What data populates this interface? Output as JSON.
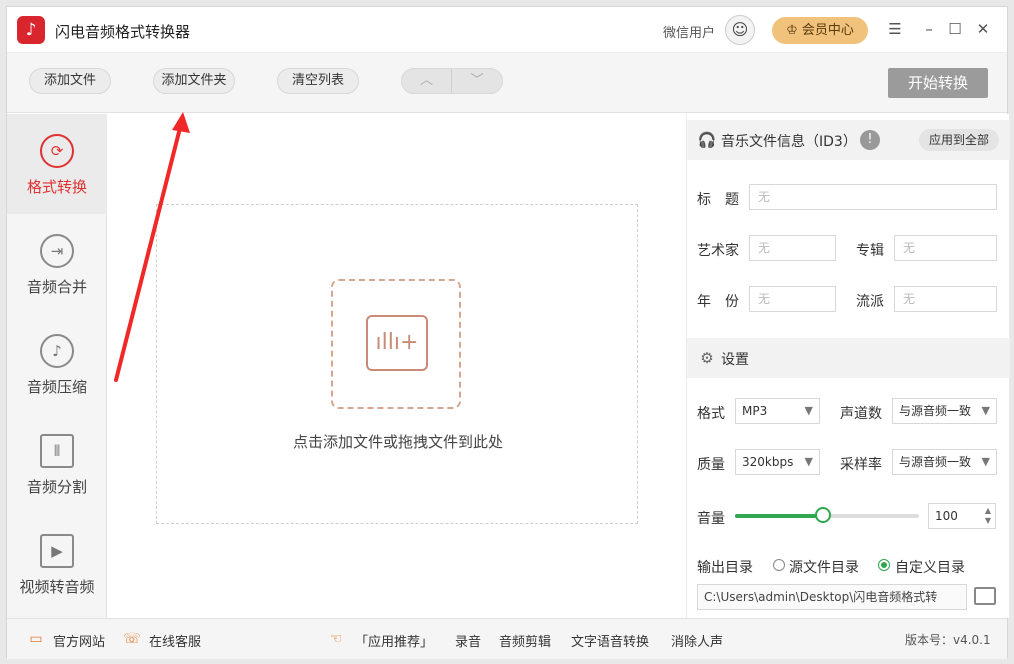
{
  "app": {
    "logo_glyph": "♪",
    "title": "闪电音频格式转换器"
  },
  "header": {
    "user_name": "微信用户",
    "avatar_glyph": "☺",
    "vip_label": "会员中心",
    "min": "–",
    "restore": "☐",
    "close": "✕",
    "menu": "☰"
  },
  "toolbar": {
    "add_file": "添加文件",
    "add_folder": "添加文件夹",
    "clear_list": "清空列表",
    "up_glyph": "︿",
    "down_glyph": "﹀",
    "start": "开始转换"
  },
  "sidebar": {
    "items": [
      {
        "label": "格式转换",
        "glyph": "⟳",
        "active": true
      },
      {
        "label": "音频合并",
        "glyph": "⇥"
      },
      {
        "label": "音频压缩",
        "glyph": "♪"
      },
      {
        "label": "音频分割",
        "glyph": "⫴"
      },
      {
        "label": "视频转音频",
        "glyph": "▶"
      }
    ]
  },
  "main": {
    "drop_glyph": "ıllı+",
    "hint": "点击添加文件或拖拽文件到此处"
  },
  "info": {
    "title": "音乐文件信息（ID3）",
    "head_glyph": "🎧",
    "warn_glyph": "!",
    "apply_all": "应用到全部",
    "title_label": "标　题",
    "title_value": "无",
    "artist_label": "艺术家",
    "artist_value": "无",
    "album_label": "专辑",
    "album_value": "无",
    "year_label": "年　份",
    "year_value": "无",
    "genre_label": "流派",
    "genre_value": "无"
  },
  "settings": {
    "title": "设置",
    "head_glyph": "⚙",
    "format_label": "格式",
    "format_value": "MP3",
    "channels_label": "声道数",
    "channels_value": "与源音频一致",
    "quality_label": "质量",
    "quality_value": "320kbps",
    "samplerate_label": "采样率",
    "samplerate_value": "与源音频一致",
    "volume_label": "音量",
    "volume_value": "100",
    "volume_level": 0.48,
    "output_label": "输出目录",
    "source_dir_label": "源文件目录",
    "custom_dir_label": "自定义目录",
    "output_path": "C:\\Users\\admin\\Desktop\\闪电音频格式转",
    "caret": "▼",
    "spin_up": "▲",
    "spin_down": "▼"
  },
  "status": {
    "website": "官方网站",
    "website_glyph": "▭",
    "support": "在线客服",
    "support_glyph": "☏",
    "promo_glyph": "☜",
    "app_recommend": "「应用推荐」",
    "record": "录音",
    "audio_edit": "音频剪辑",
    "tts": "文字语音转换",
    "vocal_remove": "消除人声",
    "version": "版本号：v4.0.1"
  },
  "colors": {
    "accent_red": "#e03232",
    "vip_gold": "#f0c27b",
    "slider_green": "#2fa84f",
    "annotation_arrow": "#f02828"
  }
}
